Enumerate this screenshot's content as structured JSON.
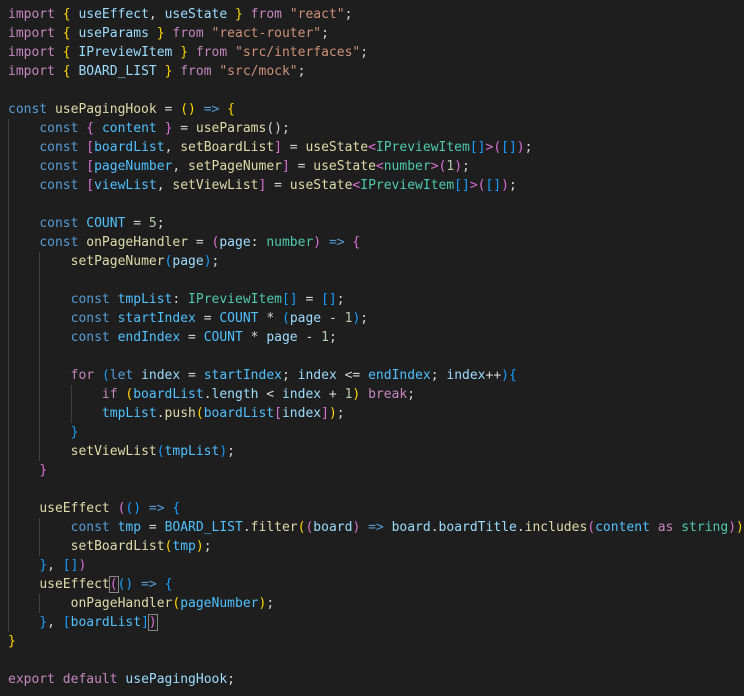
{
  "colors": {
    "background": "#1e1e1e",
    "keyword_control": "#c586c0",
    "keyword": "#569cd6",
    "function": "#dcdcaa",
    "variable": "#9cdcfe",
    "constant": "#4fc1ff",
    "type": "#4ec9b0",
    "string": "#ce9178",
    "number": "#b5cea8",
    "punctuation": "#d4d4d4",
    "bracket1": "#ffd700",
    "bracket2": "#da70d6",
    "bracket3": "#179fff"
  },
  "lines": [
    {
      "indent": 0,
      "tokens": [
        [
          "import",
          "kc"
        ],
        [
          " ",
          "p"
        ],
        [
          "{",
          "b1"
        ],
        [
          " ",
          "p"
        ],
        [
          "useEffect",
          "v"
        ],
        [
          ", ",
          "p"
        ],
        [
          "useState",
          "v"
        ],
        [
          " ",
          "p"
        ],
        [
          "}",
          "b1"
        ],
        [
          " ",
          "p"
        ],
        [
          "from",
          "kc"
        ],
        [
          " ",
          "p"
        ],
        [
          "\"react\"",
          "s"
        ],
        [
          ";",
          "p"
        ]
      ]
    },
    {
      "indent": 0,
      "tokens": [
        [
          "import",
          "kc"
        ],
        [
          " ",
          "p"
        ],
        [
          "{",
          "b1"
        ],
        [
          " ",
          "p"
        ],
        [
          "useParams",
          "v"
        ],
        [
          " ",
          "p"
        ],
        [
          "}",
          "b1"
        ],
        [
          " ",
          "p"
        ],
        [
          "from",
          "kc"
        ],
        [
          " ",
          "p"
        ],
        [
          "\"react-router\"",
          "s"
        ],
        [
          ";",
          "p"
        ]
      ]
    },
    {
      "indent": 0,
      "tokens": [
        [
          "import",
          "kc"
        ],
        [
          " ",
          "p"
        ],
        [
          "{",
          "b1"
        ],
        [
          " ",
          "p"
        ],
        [
          "IPreviewItem",
          "v"
        ],
        [
          " ",
          "p"
        ],
        [
          "}",
          "b1"
        ],
        [
          " ",
          "p"
        ],
        [
          "from",
          "kc"
        ],
        [
          " ",
          "p"
        ],
        [
          "\"src/interfaces\"",
          "s"
        ],
        [
          ";",
          "p"
        ]
      ]
    },
    {
      "indent": 0,
      "tokens": [
        [
          "import",
          "kc"
        ],
        [
          " ",
          "p"
        ],
        [
          "{",
          "b1"
        ],
        [
          " ",
          "p"
        ],
        [
          "BOARD_LIST",
          "v"
        ],
        [
          " ",
          "p"
        ],
        [
          "}",
          "b1"
        ],
        [
          " ",
          "p"
        ],
        [
          "from",
          "kc"
        ],
        [
          " ",
          "p"
        ],
        [
          "\"src/mock\"",
          "s"
        ],
        [
          ";",
          "p"
        ]
      ]
    },
    {
      "indent": 0,
      "tokens": []
    },
    {
      "indent": 0,
      "tokens": [
        [
          "const",
          "k"
        ],
        [
          " ",
          "p"
        ],
        [
          "usePagingHook",
          "f"
        ],
        [
          " = ",
          "p"
        ],
        [
          "()",
          "b1"
        ],
        [
          " ",
          "p"
        ],
        [
          "=>",
          "k"
        ],
        [
          " ",
          "p"
        ],
        [
          "{",
          "b1"
        ]
      ]
    },
    {
      "indent": 1,
      "tokens": [
        [
          "    ",
          "p"
        ],
        [
          "const",
          "k"
        ],
        [
          " ",
          "p"
        ],
        [
          "{",
          "b2"
        ],
        [
          " ",
          "p"
        ],
        [
          "content",
          "c"
        ],
        [
          " ",
          "p"
        ],
        [
          "}",
          "b2"
        ],
        [
          " = ",
          "p"
        ],
        [
          "useParams",
          "f"
        ],
        [
          "();",
          "p"
        ]
      ]
    },
    {
      "indent": 1,
      "tokens": [
        [
          "    ",
          "p"
        ],
        [
          "const",
          "k"
        ],
        [
          " ",
          "p"
        ],
        [
          "[",
          "b2"
        ],
        [
          "boardList",
          "c"
        ],
        [
          ", ",
          "p"
        ],
        [
          "setBoardList",
          "f"
        ],
        [
          "]",
          "b2"
        ],
        [
          " = ",
          "p"
        ],
        [
          "useState",
          "f"
        ],
        [
          "<",
          "b2"
        ],
        [
          "IPreviewItem",
          "t"
        ],
        [
          "[]",
          "b3"
        ],
        [
          ">",
          "b2"
        ],
        [
          "(",
          "b2"
        ],
        [
          "[]",
          "b3"
        ],
        [
          ")",
          "b2"
        ],
        [
          ";",
          "p"
        ]
      ]
    },
    {
      "indent": 1,
      "tokens": [
        [
          "    ",
          "p"
        ],
        [
          "const",
          "k"
        ],
        [
          " ",
          "p"
        ],
        [
          "[",
          "b2"
        ],
        [
          "pageNumber",
          "c"
        ],
        [
          ", ",
          "p"
        ],
        [
          "setPageNumer",
          "f"
        ],
        [
          "]",
          "b2"
        ],
        [
          " = ",
          "p"
        ],
        [
          "useState",
          "f"
        ],
        [
          "<",
          "b2"
        ],
        [
          "number",
          "t"
        ],
        [
          ">",
          "b2"
        ],
        [
          "(",
          "b2"
        ],
        [
          "1",
          "n"
        ],
        [
          ")",
          "b2"
        ],
        [
          ";",
          "p"
        ]
      ]
    },
    {
      "indent": 1,
      "tokens": [
        [
          "    ",
          "p"
        ],
        [
          "const",
          "k"
        ],
        [
          " ",
          "p"
        ],
        [
          "[",
          "b2"
        ],
        [
          "viewList",
          "c"
        ],
        [
          ", ",
          "p"
        ],
        [
          "setViewList",
          "f"
        ],
        [
          "]",
          "b2"
        ],
        [
          " = ",
          "p"
        ],
        [
          "useState",
          "f"
        ],
        [
          "<",
          "b2"
        ],
        [
          "IPreviewItem",
          "t"
        ],
        [
          "[]",
          "b3"
        ],
        [
          ">",
          "b2"
        ],
        [
          "(",
          "b2"
        ],
        [
          "[]",
          "b3"
        ],
        [
          ")",
          "b2"
        ],
        [
          ";",
          "p"
        ]
      ]
    },
    {
      "indent": 1,
      "tokens": []
    },
    {
      "indent": 1,
      "tokens": [
        [
          "    ",
          "p"
        ],
        [
          "const",
          "k"
        ],
        [
          " ",
          "p"
        ],
        [
          "COUNT",
          "c"
        ],
        [
          " = ",
          "p"
        ],
        [
          "5",
          "n"
        ],
        [
          ";",
          "p"
        ]
      ]
    },
    {
      "indent": 1,
      "tokens": [
        [
          "    ",
          "p"
        ],
        [
          "const",
          "k"
        ],
        [
          " ",
          "p"
        ],
        [
          "onPageHandler",
          "f"
        ],
        [
          " = ",
          "p"
        ],
        [
          "(",
          "b2"
        ],
        [
          "page",
          "v"
        ],
        [
          ": ",
          "p"
        ],
        [
          "number",
          "t"
        ],
        [
          ")",
          "b2"
        ],
        [
          " ",
          "p"
        ],
        [
          "=>",
          "k"
        ],
        [
          " ",
          "p"
        ],
        [
          "{",
          "b2"
        ]
      ]
    },
    {
      "indent": 2,
      "tokens": [
        [
          "        ",
          "p"
        ],
        [
          "setPageNumer",
          "f"
        ],
        [
          "(",
          "b3"
        ],
        [
          "page",
          "v"
        ],
        [
          ")",
          "b3"
        ],
        [
          ";",
          "p"
        ]
      ]
    },
    {
      "indent": 2,
      "tokens": []
    },
    {
      "indent": 2,
      "tokens": [
        [
          "        ",
          "p"
        ],
        [
          "const",
          "k"
        ],
        [
          " ",
          "p"
        ],
        [
          "tmpList",
          "c"
        ],
        [
          ": ",
          "p"
        ],
        [
          "IPreviewItem",
          "t"
        ],
        [
          "[]",
          "b3"
        ],
        [
          " = ",
          "p"
        ],
        [
          "[]",
          "b3"
        ],
        [
          ";",
          "p"
        ]
      ]
    },
    {
      "indent": 2,
      "tokens": [
        [
          "        ",
          "p"
        ],
        [
          "const",
          "k"
        ],
        [
          " ",
          "p"
        ],
        [
          "startIndex",
          "c"
        ],
        [
          " = ",
          "p"
        ],
        [
          "COUNT",
          "c"
        ],
        [
          " * ",
          "p"
        ],
        [
          "(",
          "b3"
        ],
        [
          "page",
          "v"
        ],
        [
          " - ",
          "p"
        ],
        [
          "1",
          "n"
        ],
        [
          ")",
          "b3"
        ],
        [
          ";",
          "p"
        ]
      ]
    },
    {
      "indent": 2,
      "tokens": [
        [
          "        ",
          "p"
        ],
        [
          "const",
          "k"
        ],
        [
          " ",
          "p"
        ],
        [
          "endIndex",
          "c"
        ],
        [
          " = ",
          "p"
        ],
        [
          "COUNT",
          "c"
        ],
        [
          " * ",
          "p"
        ],
        [
          "page",
          "v"
        ],
        [
          " - ",
          "p"
        ],
        [
          "1",
          "n"
        ],
        [
          ";",
          "p"
        ]
      ]
    },
    {
      "indent": 2,
      "tokens": []
    },
    {
      "indent": 2,
      "tokens": [
        [
          "        ",
          "p"
        ],
        [
          "for",
          "kc"
        ],
        [
          " ",
          "p"
        ],
        [
          "(",
          "b3"
        ],
        [
          "let",
          "k"
        ],
        [
          " ",
          "p"
        ],
        [
          "index",
          "v"
        ],
        [
          " = ",
          "p"
        ],
        [
          "startIndex",
          "c"
        ],
        [
          "; ",
          "p"
        ],
        [
          "index",
          "v"
        ],
        [
          " <= ",
          "p"
        ],
        [
          "endIndex",
          "c"
        ],
        [
          "; ",
          "p"
        ],
        [
          "index",
          "v"
        ],
        [
          "++",
          "p"
        ],
        [
          ")",
          "b3"
        ],
        [
          "{",
          "b3"
        ]
      ]
    },
    {
      "indent": 3,
      "tokens": [
        [
          "            ",
          "p"
        ],
        [
          "if",
          "kc"
        ],
        [
          " ",
          "p"
        ],
        [
          "(",
          "b1"
        ],
        [
          "boardList",
          "c"
        ],
        [
          ".",
          "p"
        ],
        [
          "length",
          "v"
        ],
        [
          " < ",
          "p"
        ],
        [
          "index",
          "v"
        ],
        [
          " + ",
          "p"
        ],
        [
          "1",
          "n"
        ],
        [
          ")",
          "b1"
        ],
        [
          " ",
          "p"
        ],
        [
          "break",
          "kc"
        ],
        [
          ";",
          "p"
        ]
      ]
    },
    {
      "indent": 3,
      "tokens": [
        [
          "            ",
          "p"
        ],
        [
          "tmpList",
          "c"
        ],
        [
          ".",
          "p"
        ],
        [
          "push",
          "f"
        ],
        [
          "(",
          "b1"
        ],
        [
          "boardList",
          "c"
        ],
        [
          "[",
          "b2"
        ],
        [
          "index",
          "v"
        ],
        [
          "]",
          "b2"
        ],
        [
          ")",
          "b1"
        ],
        [
          ";",
          "p"
        ]
      ]
    },
    {
      "indent": 2,
      "tokens": [
        [
          "        ",
          "p"
        ],
        [
          "}",
          "b3"
        ]
      ]
    },
    {
      "indent": 2,
      "tokens": [
        [
          "        ",
          "p"
        ],
        [
          "setViewList",
          "f"
        ],
        [
          "(",
          "b3"
        ],
        [
          "tmpList",
          "c"
        ],
        [
          ")",
          "b3"
        ],
        [
          ";",
          "p"
        ]
      ]
    },
    {
      "indent": 1,
      "tokens": [
        [
          "    ",
          "p"
        ],
        [
          "}",
          "b2"
        ]
      ]
    },
    {
      "indent": 1,
      "tokens": []
    },
    {
      "indent": 1,
      "tokens": [
        [
          "    ",
          "p"
        ],
        [
          "useEffect",
          "f"
        ],
        [
          " ",
          "p"
        ],
        [
          "(",
          "b2"
        ],
        [
          "()",
          "b3"
        ],
        [
          " ",
          "p"
        ],
        [
          "=>",
          "k"
        ],
        [
          " ",
          "p"
        ],
        [
          "{",
          "b3"
        ]
      ]
    },
    {
      "indent": 2,
      "tokens": [
        [
          "        ",
          "p"
        ],
        [
          "const",
          "k"
        ],
        [
          " ",
          "p"
        ],
        [
          "tmp",
          "c"
        ],
        [
          " = ",
          "p"
        ],
        [
          "BOARD_LIST",
          "c"
        ],
        [
          ".",
          "p"
        ],
        [
          "filter",
          "f"
        ],
        [
          "(",
          "b1"
        ],
        [
          "(",
          "b2"
        ],
        [
          "board",
          "v"
        ],
        [
          ")",
          "b2"
        ],
        [
          " ",
          "p"
        ],
        [
          "=>",
          "k"
        ],
        [
          " ",
          "p"
        ],
        [
          "board",
          "v"
        ],
        [
          ".",
          "p"
        ],
        [
          "boardTitle",
          "v"
        ],
        [
          ".",
          "p"
        ],
        [
          "includes",
          "f"
        ],
        [
          "(",
          "b2"
        ],
        [
          "content",
          "c"
        ],
        [
          " ",
          "p"
        ],
        [
          "as",
          "kc"
        ],
        [
          " ",
          "p"
        ],
        [
          "string",
          "t"
        ],
        [
          ")",
          "b2"
        ],
        [
          ")",
          "b1"
        ]
      ]
    },
    {
      "indent": 2,
      "tokens": [
        [
          "        ",
          "p"
        ],
        [
          "setBoardList",
          "f"
        ],
        [
          "(",
          "b1"
        ],
        [
          "tmp",
          "c"
        ],
        [
          ")",
          "b1"
        ],
        [
          ";",
          "p"
        ]
      ]
    },
    {
      "indent": 1,
      "tokens": [
        [
          "    ",
          "p"
        ],
        [
          "}",
          "b3"
        ],
        [
          ", ",
          "p"
        ],
        [
          "[]",
          "b3"
        ],
        [
          ")",
          "b2"
        ]
      ]
    },
    {
      "indent": 1,
      "tokens": [
        [
          "    ",
          "p"
        ],
        [
          "useEffect",
          "f"
        ],
        [
          "(",
          "b2"
        ],
        [
          "()",
          "b3"
        ],
        [
          " ",
          "p"
        ],
        [
          "=>",
          "k"
        ],
        [
          " ",
          "p"
        ],
        [
          "{",
          "b3"
        ]
      ]
    },
    {
      "indent": 2,
      "tokens": [
        [
          "        ",
          "p"
        ],
        [
          "onPageHandler",
          "f"
        ],
        [
          "(",
          "b1"
        ],
        [
          "pageNumber",
          "c"
        ],
        [
          ")",
          "b1"
        ],
        [
          ";",
          "p"
        ]
      ]
    },
    {
      "indent": 1,
      "tokens": [
        [
          "    ",
          "p"
        ],
        [
          "}",
          "b3"
        ],
        [
          ", ",
          "p"
        ],
        [
          "[",
          "b3"
        ],
        [
          "boardList",
          "c"
        ],
        [
          "]",
          "b3"
        ],
        [
          ")",
          "b2"
        ]
      ]
    },
    {
      "indent": 0,
      "tokens": [
        [
          "}",
          "b1"
        ]
      ]
    },
    {
      "indent": 0,
      "tokens": []
    },
    {
      "indent": 0,
      "tokens": [
        [
          "export",
          "kc"
        ],
        [
          " ",
          "p"
        ],
        [
          "default",
          "kc"
        ],
        [
          " ",
          "p"
        ],
        [
          "usePagingHook",
          "v"
        ],
        [
          ";",
          "p"
        ]
      ]
    }
  ]
}
